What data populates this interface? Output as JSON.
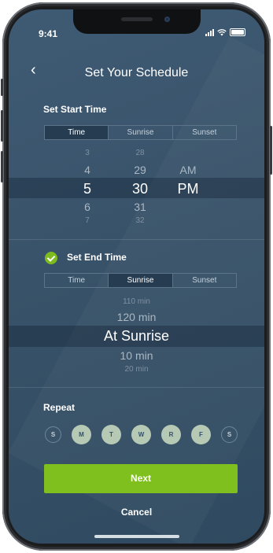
{
  "status": {
    "time": "9:41"
  },
  "header": {
    "back_glyph": "‹",
    "title": "Set Your Schedule"
  },
  "start": {
    "label": "Set Start Time",
    "tabs": [
      "Time",
      "Sunrise",
      "Sunset"
    ],
    "active_tab": "Time",
    "hours": [
      "3",
      "4",
      "5",
      "6",
      "7"
    ],
    "minutes": [
      "28",
      "29",
      "30",
      "31",
      "32"
    ],
    "ampm": [
      "AM",
      "PM"
    ],
    "selected": {
      "hour": "5",
      "minute": "30",
      "period": "PM"
    }
  },
  "end": {
    "enabled": true,
    "label": "Set End Time",
    "tabs": [
      "Time",
      "Sunrise",
      "Sunset"
    ],
    "active_tab": "Sunrise",
    "offsets": [
      "110 min",
      "120 min",
      "At Sunrise",
      "10 min",
      "20 min"
    ],
    "selected": "At Sunrise"
  },
  "repeat": {
    "label": "Repeat",
    "days": [
      {
        "label": "S",
        "on": false
      },
      {
        "label": "M",
        "on": true
      },
      {
        "label": "T",
        "on": true
      },
      {
        "label": "W",
        "on": true
      },
      {
        "label": "R",
        "on": true
      },
      {
        "label": "F",
        "on": true
      },
      {
        "label": "S",
        "on": false
      }
    ]
  },
  "actions": {
    "next": "Next",
    "cancel": "Cancel"
  },
  "colors": {
    "accent": "#7fbf1e",
    "background": "#3b566e",
    "day_on": "#b6c9b4"
  },
  "icons": {
    "back": "chevron-left-icon",
    "check": "check-circle-icon",
    "signal": "signal-icon",
    "wifi": "wifi-icon",
    "battery": "battery-icon"
  }
}
